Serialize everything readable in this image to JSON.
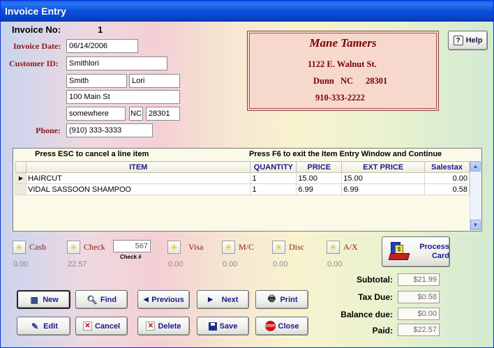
{
  "window": {
    "title": "Invoice Entry"
  },
  "invoice": {
    "no_label": "Invoice No:",
    "no_value": "1",
    "date_label": "Invoice Date:",
    "date_value": "06/14/2006"
  },
  "customer": {
    "id_label": "Customer ID:",
    "id_value": "Smithlori",
    "last": "Smith",
    "first": "Lori",
    "address": "100 Main St",
    "city": "somewhere",
    "state": "NC",
    "zip": "28301",
    "phone_label": "Phone:",
    "phone": "(910) 333-3333"
  },
  "shop": {
    "name": "Mane Tamers",
    "street": "1122 E. Walnut St.",
    "city": "Dunn",
    "state": "NC",
    "zip": "28301",
    "phone": "910-333-2222"
  },
  "help": {
    "label": "Help",
    "icon": "question-icon"
  },
  "items": {
    "hint_left": "Press ESC to cancel a line item",
    "hint_right": "Press F6 to exit the Item Entry Window and Continue",
    "columns": [
      "ITEM",
      "QUANTITY",
      "PRICE",
      "EXT PRICE",
      "Salestax"
    ],
    "rows": [
      {
        "item": "HAIRCUT",
        "quantity": "1",
        "price": "15.00",
        "ext": "15.00",
        "tax": "0.00"
      },
      {
        "item": "VIDAL SASSOON SHAMPOO",
        "quantity": "1",
        "price": "6.99",
        "ext": "6.99",
        "tax": "0.58"
      }
    ]
  },
  "payments": {
    "cash": {
      "label": "Cash",
      "amount": "0.00"
    },
    "check": {
      "label": "Check",
      "amount": "22.57",
      "number": "567",
      "number_label": "Check #"
    },
    "visa": {
      "label": "Visa",
      "amount": "0.00"
    },
    "mc": {
      "label": "M/C",
      "amount": "0.00"
    },
    "disc": {
      "label": "Disc",
      "amount": "0.00"
    },
    "ax": {
      "label": "A/X",
      "amount": "0.00"
    },
    "process": {
      "line1": "Process",
      "line2": "Card"
    }
  },
  "totals": {
    "subtotal_label": "Subtotal:",
    "subtotal": "$21.99",
    "tax_label": "Tax Due:",
    "tax": "$0.58",
    "balance_label": "Balance due:",
    "balance": "$0.00",
    "paid_label": "Paid:",
    "paid": "$22.57"
  },
  "buttons": {
    "new": "New",
    "find": "Find",
    "previous": "Previous",
    "next": "Next",
    "print": "Print",
    "edit": "Edit",
    "cancel": "Cancel",
    "delete": "Delete",
    "save": "Save",
    "close": "Close"
  },
  "colors": {
    "title_bar": "#0842c4",
    "label_red": "#8b1a1a",
    "shop_bg": "#f7d8cc",
    "header_blue": "#1a1a8a"
  }
}
